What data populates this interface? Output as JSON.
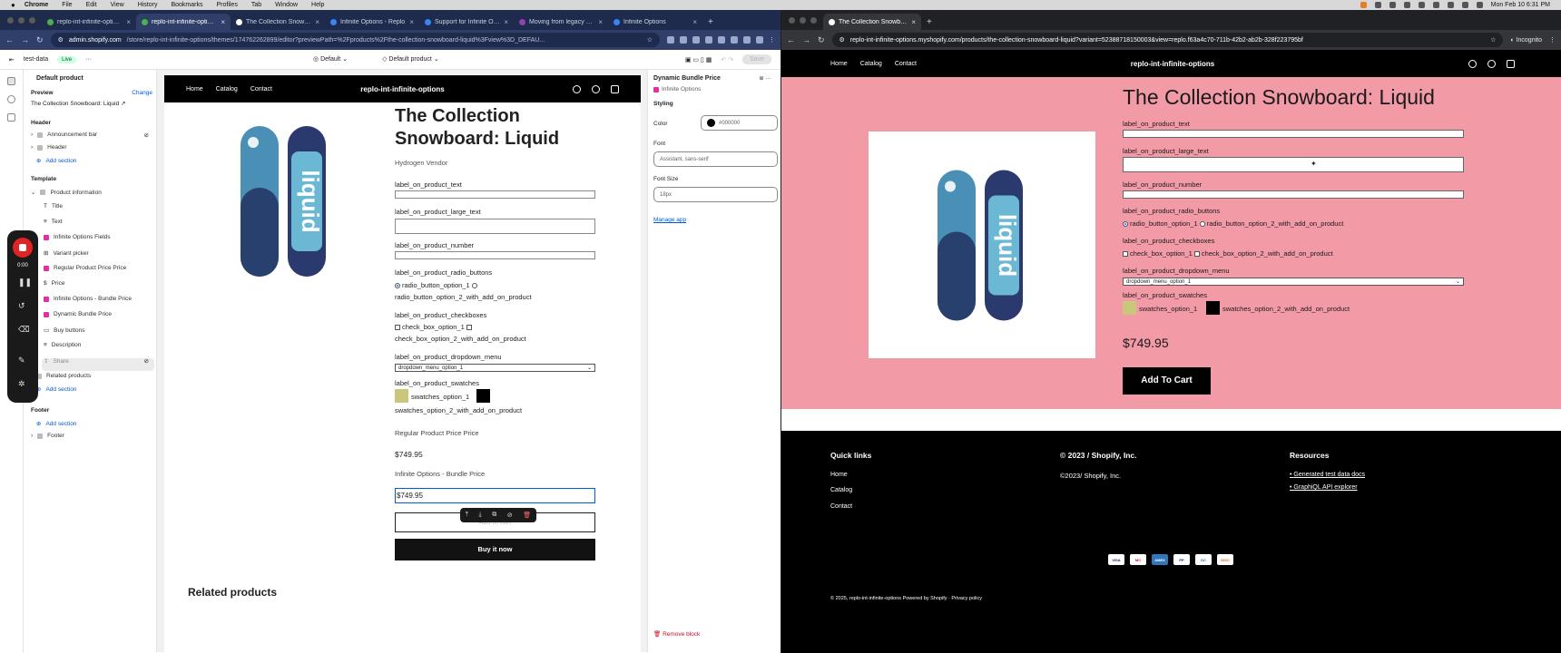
{
  "menubar": {
    "app": "Chrome",
    "items": [
      "File",
      "Edit",
      "View",
      "History",
      "Bookmarks",
      "Profiles",
      "Tab",
      "Window",
      "Help"
    ],
    "clock": "Mon Feb 10  6:31 PM"
  },
  "left_window": {
    "tabs": [
      {
        "label": "replo-int-infinite-options",
        "active": false
      },
      {
        "label": "replo-int-infinite-options",
        "active": true
      },
      {
        "label": "The Collection Snowboard",
        "active": false
      },
      {
        "label": "Infinite Options - Replo",
        "active": false
      },
      {
        "label": "Support for Infinite Options",
        "active": false
      },
      {
        "label": "Moving from legacy bund",
        "active": false
      },
      {
        "label": "Infinite Options",
        "active": false
      }
    ],
    "url_host": "admin.shopify.com",
    "url_path": "/store/replo-int-infinite-options/themes/174762262899/editor?previewPath=%2Fproducts%2Fthe-collection-snowboard-liquid%3Fview%3D_DEFAU...",
    "admin": {
      "store": "test-data",
      "status": "Live",
      "theme_select": "Default",
      "template_select": "Default product",
      "save": "Save"
    },
    "sidebar": {
      "title": "Default product",
      "preview_label": "Preview",
      "preview_change": "Change",
      "preview_value": "The Collection Snowboard: Liquid",
      "header_heading": "Header",
      "announcement": "Announcement bar",
      "header_item": "Header",
      "add_section": "Add section",
      "template_heading": "Template",
      "product_info": "Product information",
      "blocks": [
        "Title",
        "Text",
        "Infinite Options Fields",
        "Variant picker",
        "Regular Product Price Price",
        "Price",
        "Infinite Options - Bundle Price",
        "Dynamic Bundle Price",
        "Buy buttons",
        "Description",
        "Share"
      ],
      "related": "Related products",
      "footer_heading": "Footer",
      "footer_item": "Footer"
    },
    "recorder": {
      "time": "0:00"
    },
    "preview": {
      "nav": [
        "Home",
        "Catalog",
        "Contact"
      ],
      "brand": "replo-int-infinite-options",
      "title": "The Collection Snowboard: Liquid",
      "vendor": "Hydrogen Vendor",
      "labels": {
        "text": "label_on_product_text",
        "large_text": "label_on_product_large_text",
        "number": "label_on_product_number",
        "radio": "label_on_product_radio_buttons",
        "radio1": "radio_button_option_1",
        "radio2": "radio_button_option_2_with_add_on_product",
        "checkbox": "label_on_product_checkboxes",
        "cb1": "check_box_option_1",
        "cb2": "check_box_option_2_with_add_on_product",
        "dropdown": "label_on_product_dropdown_menu",
        "dropdown_value": "dropdown_menu_option_1",
        "swatches": "label_on_product_swatches",
        "sw1": "swatches_option_1",
        "sw2": "swatches_option_2_with_add_on_product"
      },
      "regular_price_label": "Regular Product Price Price",
      "price": "$749.95",
      "bundle_label": "Infinite Options - Bundle Price",
      "bundle_price": "$749.95",
      "add_to_cart": "Add to cart",
      "buy_now": "Buy it now",
      "related": "Related products"
    },
    "props": {
      "block": "Dynamic Bundle Price",
      "app": "Infinite Options",
      "styling": "Styling",
      "color_label": "Color",
      "color_value": "#000000",
      "font_label": "Font",
      "font_value": "Assistant, sans-serif",
      "size_label": "Font Size",
      "size_value": "18px",
      "manage": "Manage app",
      "remove": "Remove block"
    }
  },
  "right_window": {
    "tab": "The Collection Snowboard: Li",
    "url": "replo-int-infinite-options.myshopify.com/products/the-collection-snowboard-liquid?variant=52388718150003&view=replo.f63a4c70-711b-42b2-ab2b-328f223795bf",
    "incognito": "Incognito",
    "nav": [
      "Home",
      "Catalog",
      "Contact"
    ],
    "brand": "replo-int-infinite-options",
    "title": "The Collection Snowboard: Liquid",
    "price": "$749.95",
    "add_to_cart": "Add To Cart",
    "footer": {
      "quick_links": "Quick links",
      "links": [
        "Home",
        "Catalog",
        "Contact"
      ],
      "copyright_h": "© 2023 / Shopify, Inc.",
      "copyright_t": "©2023/ Shopify, Inc.",
      "resources": "Resources",
      "res_links": [
        "Generated test data docs",
        "GraphiQL API explorer"
      ],
      "bottom": "© 2025, replo-int-infinite-options Powered by Shopify  ·  Privacy policy",
      "payments": [
        "VISA",
        "MC",
        "AMEX",
        "PP",
        "DC",
        "DISC"
      ]
    }
  },
  "colors": {
    "hero": "#f29aa6",
    "swatch1": "#c9c77c",
    "swatch2": "#000000",
    "accent": "#005bd3"
  }
}
